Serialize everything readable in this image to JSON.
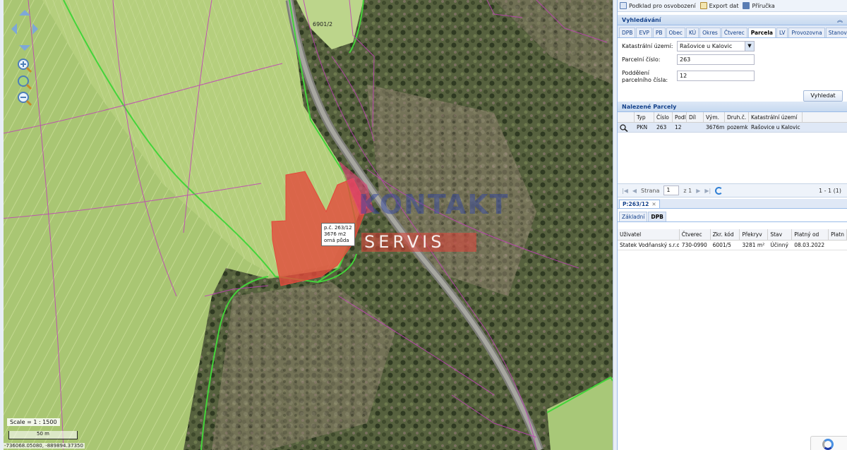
{
  "map": {
    "road_label": "6901/2",
    "parcel_label": "p.č. 263/12\n3676 m2\norná půda",
    "watermark_top": "KONTAKT",
    "watermark_bottom": "SERVIS",
    "scale_text": "Scale = 1 : 1500",
    "scale_bar_text": "50 m",
    "coords_text": "-736068.05080, -889894.37350",
    "colors": {
      "parcel_fill": "#e34a3c",
      "parcel_boundary": "#c040b8",
      "zone_boundary": "#44d43a"
    }
  },
  "toolbar": {
    "items": [
      {
        "label": "Podklad pro osvobození",
        "icon": "document-icon"
      },
      {
        "label": "Export dat",
        "icon": "export-icon"
      },
      {
        "label": "Příručka",
        "icon": "book-icon"
      }
    ]
  },
  "search": {
    "title": "Vyhledávání",
    "tabs": [
      "DPB",
      "EVP",
      "PB",
      "Obec",
      "KÚ",
      "Okres",
      "Čtverec",
      "Parcela",
      "LV",
      "Provozovna",
      "Stanoviště včel"
    ],
    "active_tab": "Parcela",
    "fields": {
      "katastr_label": "Katastrální území:",
      "katastr_value": "Rašovice u Kalovic",
      "parcel_label": "Parcelní číslo:",
      "parcel_value": "263",
      "sub_label": "Poddělení parcelního čísla:",
      "sub_value": "12"
    },
    "button": "Vyhledat"
  },
  "results": {
    "title": "Nalezené Parcely",
    "columns": [
      "Typ",
      "Číslo",
      "Podl.",
      "Díl",
      "Vým.",
      "Druh.č.",
      "Katastrální území"
    ],
    "rows": [
      {
        "typ": "PKN",
        "cislo": "263",
        "podl": "12",
        "dil": "",
        "vym": "3676m²",
        "druh": "pozemk...",
        "ku": "Rašovice u Kalovic"
      }
    ]
  },
  "pager": {
    "page_label": "Strana",
    "page": "1",
    "of": "z 1",
    "range": "1 - 1 (1)"
  },
  "detail": {
    "tab": "P:263/12",
    "subtabs": [
      "Základní",
      "DPB"
    ],
    "active_subtab": "DPB",
    "columns": [
      "Uživatel",
      "Čtverec",
      "Zkr. kód",
      "Překryv",
      "Stav",
      "Platný od",
      "Platn"
    ],
    "rows": [
      {
        "uzivatel": "Statek Vodňanský s.r.o.",
        "ctverec": "730-0990",
        "kod": "6001/5",
        "prekryv": "3281 m²",
        "stav": "Účinný",
        "od": "08.03.2022",
        "do": ""
      }
    ]
  }
}
